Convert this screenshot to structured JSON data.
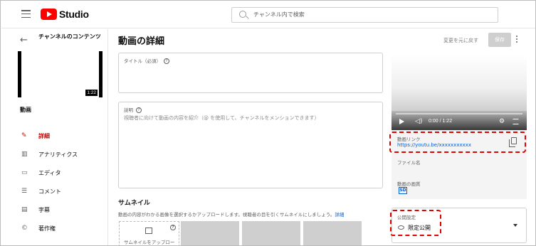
{
  "header": {
    "app_name": "Studio",
    "search_placeholder": "チャンネル内で検索"
  },
  "sidebar": {
    "title": "チャンネルのコンテンツ",
    "video_duration": "1:22",
    "video_label": "動画",
    "items": [
      {
        "icon": "pencil-icon",
        "label": "詳細",
        "active": true
      },
      {
        "icon": "analytics-icon",
        "label": "アナリティクス",
        "active": false
      },
      {
        "icon": "editor-icon",
        "label": "エディタ",
        "active": false
      },
      {
        "icon": "comments-icon",
        "label": "コメント",
        "active": false
      },
      {
        "icon": "subtitles-icon",
        "label": "字幕",
        "active": false
      },
      {
        "icon": "copyright-icon",
        "label": "著作権",
        "active": false
      }
    ]
  },
  "main": {
    "page_title": "動画の詳細",
    "undo_label": "変更を元に戻す",
    "save_label": "保存",
    "title_field": {
      "label": "タイトル（必須）",
      "value": ""
    },
    "description_field": {
      "label": "説明",
      "placeholder": "視聴者に向けて動画の内容を紹介（@ を使用して、チャンネルをメンションできます）"
    },
    "thumbnail": {
      "heading": "サムネイル",
      "description": "動画の内容がわかる画像を選択するかアップロードします。視聴者の目を引くサムネイルにしましょう。",
      "link": "詳細",
      "upload_label": "サムネイルをアップロー"
    }
  },
  "right_panel": {
    "time_display": "0:00 / 1:22",
    "link_label": "動画リンク",
    "link_url": "https://youtu.be/xxxxxxxxxxx",
    "filename_label": "ファイル名",
    "quality_label": "動画の画質",
    "quality_badge": "SD",
    "visibility_label": "公開設定",
    "visibility_value": "限定公開"
  },
  "colors": {
    "accent_red": "#cc0000",
    "link_blue": "#065fd4",
    "highlight_red": "#e30000"
  }
}
